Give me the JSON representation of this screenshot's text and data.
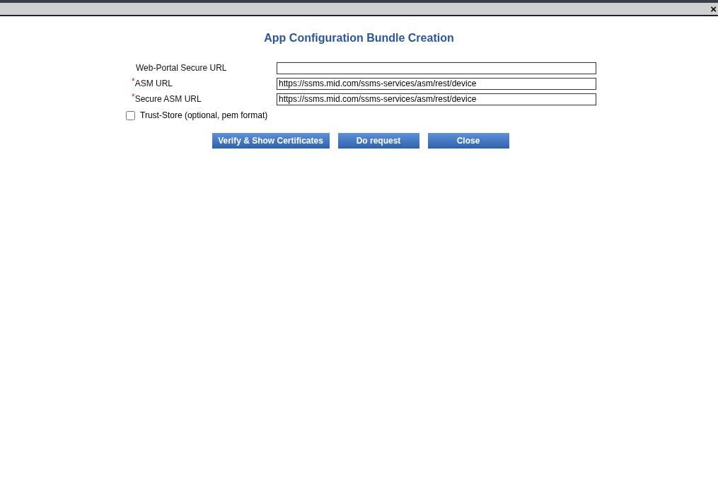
{
  "dialog": {
    "close_glyph": "×",
    "title": "App Configuration Bundle Creation"
  },
  "fields": [
    {
      "label": "Web-Portal Secure URL",
      "required": false
    },
    {
      "label": "ASM URL",
      "required": true,
      "value": "https://ssms.mid.com/ssms-services/asm/rest/device"
    },
    {
      "label": "Secure ASM URL",
      "required": true,
      "value": "https://ssms.mid.com/ssms-services/asm/rest/device"
    }
  ],
  "required_mark": "*",
  "trust_store": {
    "label": "Trust-Store (optional, pem format)",
    "checked": false
  },
  "buttons": [
    "Verify & Show Certificates",
    "Do request",
    "Close"
  ]
}
